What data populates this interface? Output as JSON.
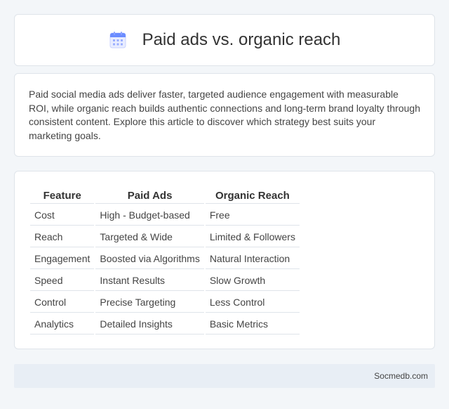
{
  "header": {
    "title": "Paid ads vs. organic reach",
    "icon": "calendar-icon"
  },
  "intro": {
    "text": "Paid social media ads deliver faster, targeted audience engagement with measurable ROI, while organic reach builds authentic connections and long-term brand loyalty through consistent content. Explore this article to discover which strategy best suits your marketing goals."
  },
  "table": {
    "headers": [
      "Feature",
      "Paid Ads",
      "Organic Reach"
    ],
    "rows": [
      [
        "Cost",
        "High - Budget-based",
        "Free"
      ],
      [
        "Reach",
        "Targeted & Wide",
        "Limited & Followers"
      ],
      [
        "Engagement",
        "Boosted via Algorithms",
        "Natural Interaction"
      ],
      [
        "Speed",
        "Instant Results",
        "Slow Growth"
      ],
      [
        "Control",
        "Precise Targeting",
        "Less Control"
      ],
      [
        "Analytics",
        "Detailed Insights",
        "Basic Metrics"
      ]
    ]
  },
  "footer": {
    "text": "Socmedb.com"
  },
  "colors": {
    "background": "#f3f6f9",
    "card": "#ffffff",
    "footer": "#e8eef5",
    "icon_accent": "#6b8cff"
  }
}
